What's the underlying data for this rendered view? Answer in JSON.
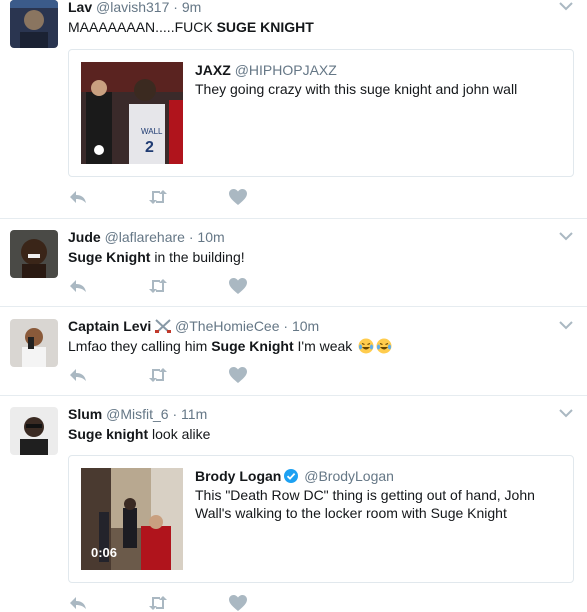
{
  "tweets": [
    {
      "name": "Lav",
      "handle": "@lavish317",
      "time": "9m",
      "text_plain": "MAAAAAAAN.....FUCK ",
      "text_bold": "SUGE KNIGHT",
      "quote": {
        "name": "JAXZ",
        "handle": "@HIPHOPJAXZ",
        "text": "They going crazy with this suge knight and john wall"
      }
    },
    {
      "name": "Jude",
      "handle": "@laflarehare",
      "time": "10m",
      "text_bold": "Suge Knight",
      "text_plain": " in the building!"
    },
    {
      "name": "Captain Levi",
      "handle": "@TheHomieCee",
      "time": "10m",
      "text_plain": "Lmfao they calling him ",
      "text_bold": "Suge Knight",
      "text_after": " I'm weak"
    },
    {
      "name": "Slum",
      "handle": "@Misfit_6",
      "time": "11m",
      "text_bold": "Suge knight",
      "text_plain": " look alike",
      "quote": {
        "name": "Brody Logan",
        "handle": "@BrodyLogan",
        "text": "This \"Death Row DC\" thing is getting out of hand, John Wall's walking to the locker room with Suge Knight",
        "duration": "0:06"
      }
    }
  ],
  "separator": "·",
  "icons": {
    "reply": "reply-icon",
    "retweet": "retweet-icon",
    "like": "heart-icon",
    "caret": "chevron-down-icon",
    "verified": "verified-badge-icon",
    "emoji": "tears-of-joy-emoji"
  },
  "colors": {
    "name": "#14171a",
    "secondary": "#657786",
    "action_icon": "#aab8c2",
    "verified": "#1da1f2",
    "divider": "#e6ecf0"
  }
}
